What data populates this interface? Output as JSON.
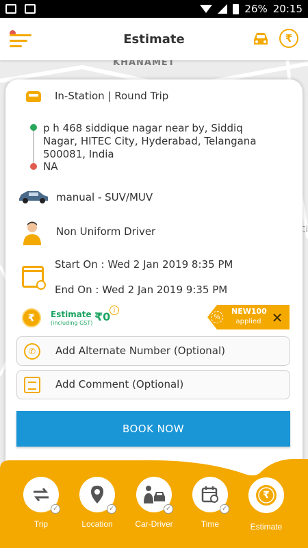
{
  "status_bar": {
    "battery": "26%",
    "time": "20:15"
  },
  "header": {
    "title": "Estimate"
  },
  "map": {
    "label": "KHANAMET",
    "side_text": "Ci"
  },
  "trip": {
    "type": "In-Station | Round Trip",
    "pickup": "p h 468 siddique nagar near by, Siddiq Nagar, HITEC City, Hyderabad, Telangana 500081, India",
    "drop": "NA",
    "vehicle": "manual - SUV/MUV",
    "driver": "Non Uniform Driver",
    "start": "Start On : Wed 2 Jan 2019 8:35 PM",
    "end": "End On : Wed 2 Jan 2019 9:35 PM"
  },
  "estimate": {
    "label": "Estimate :",
    "sub_label": "(including GST)",
    "value": "₹0",
    "currency_symbol": "₹"
  },
  "promo": {
    "code": "NEW100",
    "status": "applied"
  },
  "fields": {
    "alternate_number": "Add Alternate Number (Optional)",
    "comment": "Add Comment (Optional)"
  },
  "book_button": "BOOK NOW",
  "bottom_nav": [
    {
      "label": "Trip",
      "icon": "swap-arrows-icon",
      "checked": true
    },
    {
      "label": "Location",
      "icon": "location-pin-icon",
      "checked": true
    },
    {
      "label": "Car-Driver",
      "icon": "car-driver-icon",
      "checked": true
    },
    {
      "label": "Time",
      "icon": "calendar-icon",
      "checked": true
    },
    {
      "label": "Estimate",
      "icon": "rupee-icon",
      "active": true
    }
  ],
  "colors": {
    "accent": "#f4a900",
    "primary_button": "#1a96d6",
    "success": "#1fa463",
    "pickup_dot": "#29a65a",
    "drop_dot": "#e05a4f"
  }
}
